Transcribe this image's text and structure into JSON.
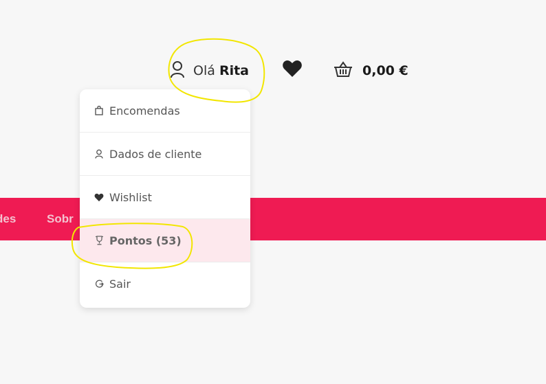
{
  "header": {
    "greeting": "Olá",
    "user_name": "Rita",
    "cart_total": "0,00 €"
  },
  "nav": {
    "items": [
      {
        "label": "des"
      },
      {
        "label": "Sobr"
      }
    ]
  },
  "account_menu": {
    "items": [
      {
        "label": "Encomendas",
        "icon": "shopping-bag-icon"
      },
      {
        "label": "Dados de cliente",
        "icon": "user-icon"
      },
      {
        "label": "Wishlist",
        "icon": "heart-icon"
      },
      {
        "label": "Pontos (53)",
        "icon": "trophy-icon",
        "active": true
      },
      {
        "label": "Sair",
        "icon": "logout-icon"
      }
    ]
  },
  "colors": {
    "brand_pink": "#ef1b53",
    "active_bg": "#fde8ed",
    "annotation": "#f2e600"
  }
}
